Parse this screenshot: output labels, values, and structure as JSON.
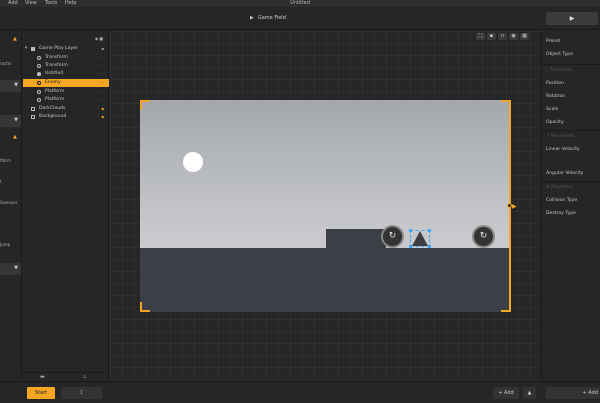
{
  "menu": {
    "items": [
      "Add",
      "View",
      "Tools",
      "Help"
    ],
    "window_title": "Untitled"
  },
  "toolbar": {
    "doc_title": "Game Field",
    "play_icon": "play-icon"
  },
  "left_strip": {
    "labels": [
      "racter",
      "tform",
      "Sweeper",
      "Jump"
    ]
  },
  "layers": {
    "items": [
      {
        "label": "Game Play Layer",
        "icon": "layer-group-icon",
        "selected": false
      },
      {
        "label": "Transform",
        "icon": "transform-icon",
        "selected": false
      },
      {
        "label": "Transform",
        "icon": "transform-icon",
        "selected": false
      },
      {
        "label": "Untitled",
        "icon": "person-icon",
        "selected": false
      },
      {
        "label": "Enemy",
        "icon": "target-icon",
        "selected": true
      },
      {
        "label": "Platform",
        "icon": "target-icon",
        "selected": false
      },
      {
        "label": "Platform",
        "icon": "target-icon",
        "selected": false
      },
      {
        "label": "DarkClouds",
        "icon": "image-icon",
        "selected": false
      },
      {
        "label": "Background",
        "icon": "image-icon",
        "selected": false
      }
    ]
  },
  "properties": {
    "preset_label": "Preset",
    "object_type_label": "Object Type",
    "transform_section": "Transform",
    "position_label": "Position",
    "rotation_label": "Rotation",
    "scale_label": "Scale",
    "opacity_label": "Opacity",
    "movement_section": "Movement",
    "linear_velocity_label": "Linear Velocity",
    "angular_velocity_label": "Angular Velocity",
    "properties_section": "Properties",
    "collision_type_label": "Collision Type",
    "destroy_type_label": "Destroy Type"
  },
  "bottom": {
    "start_label": "Start",
    "count_value": "1",
    "add_label": "+ Add",
    "add_label_right": "+ Add"
  },
  "colors": {
    "accent": "#f5a623",
    "selection": "#3fa9f5",
    "panel": "#262626"
  }
}
